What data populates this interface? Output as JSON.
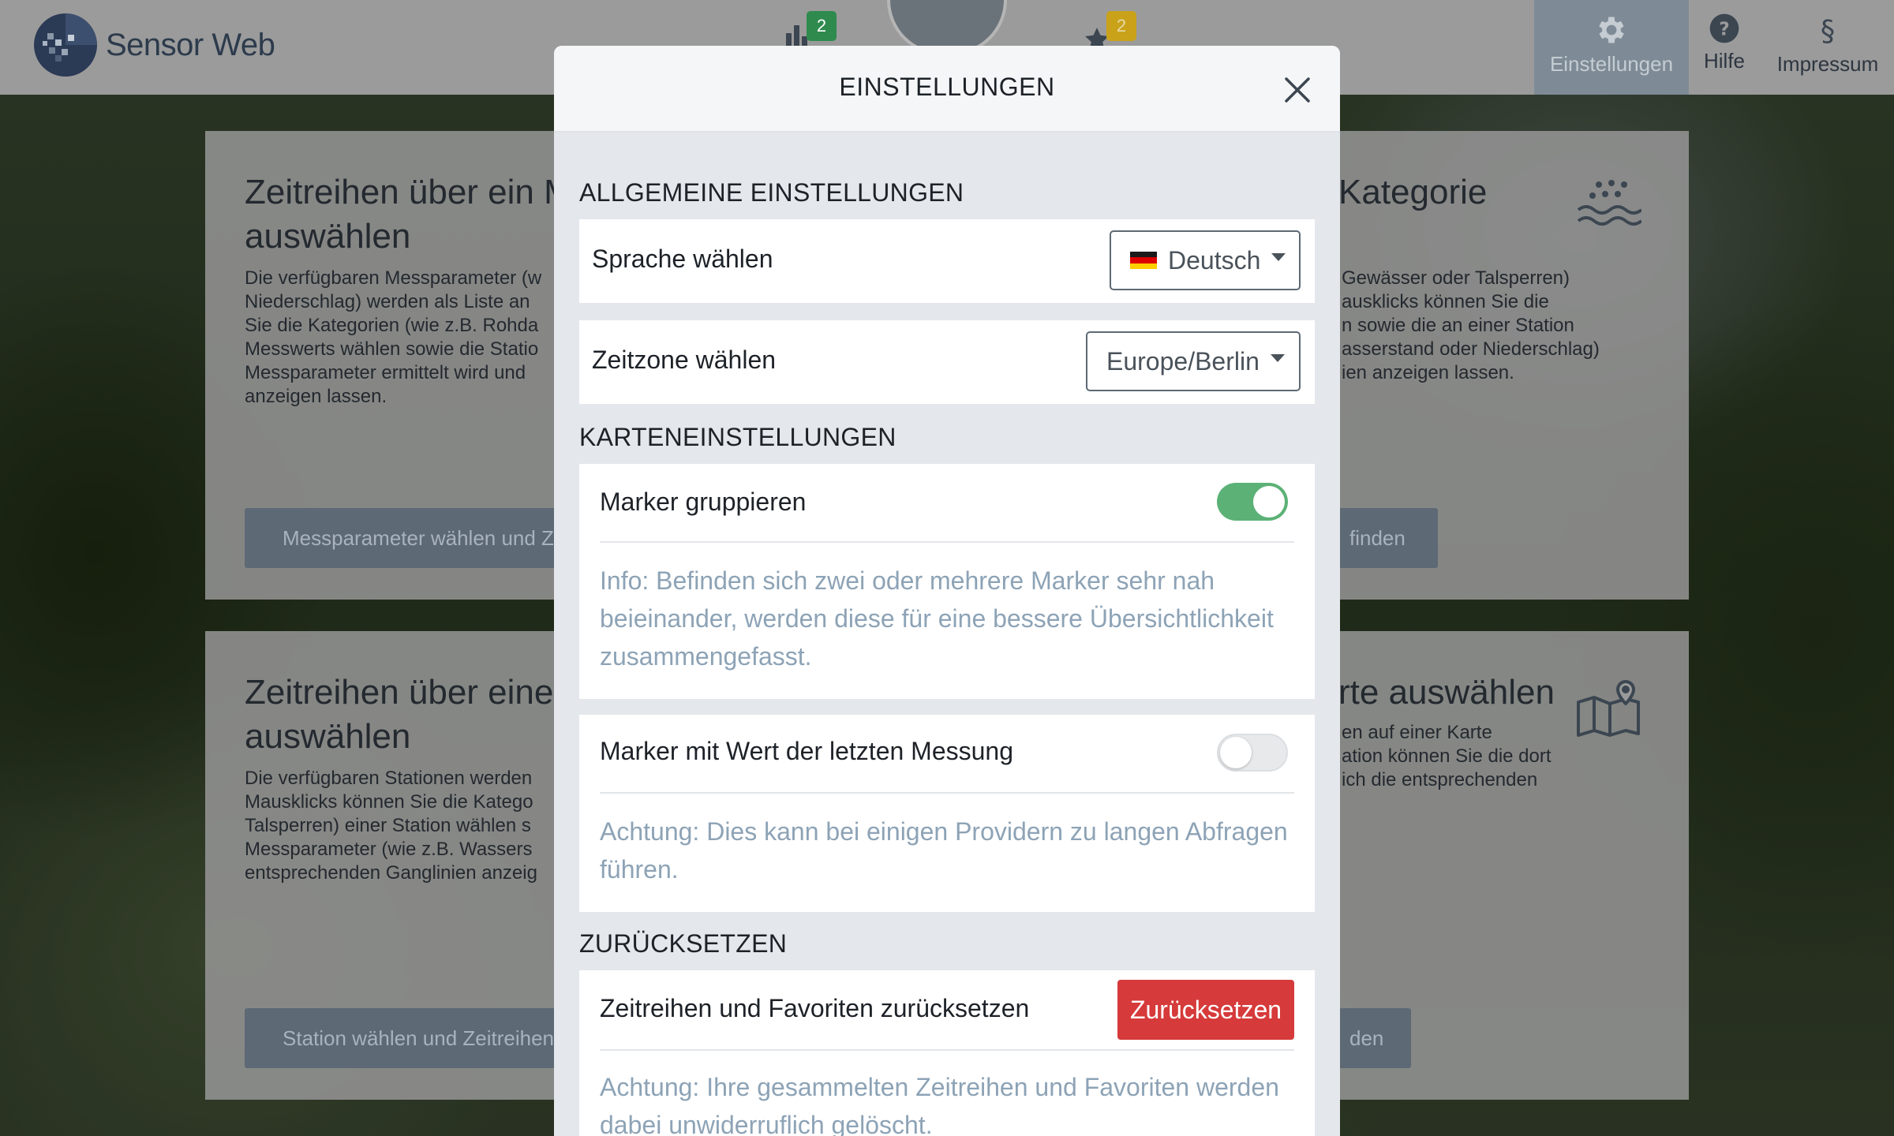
{
  "app": {
    "logo_text": "Sensor Web"
  },
  "topnav": {
    "diagram_badge": "2",
    "favorites_badge": "2",
    "items": [
      {
        "label": "Einstellungen",
        "icon": "gear-icon"
      },
      {
        "label": "Hilfe",
        "icon": "help-icon"
      },
      {
        "label": "Impressum",
        "icon": "paragraph-icon"
      }
    ]
  },
  "background_cards": {
    "card1": {
      "title_line1": "Zeitreihen über ein M",
      "title_line2": "auswählen",
      "text": [
        "Die verfügbaren Messparameter (w",
        "Niederschlag) werden als Liste an",
        "Sie die Kategorien (wie z.B. Rohda",
        "Messwerts wählen sowie die Statio",
        "Messparameter ermittelt wird und",
        "anzeigen lassen."
      ],
      "button": "Messparameter wählen und Z"
    },
    "card2": {
      "title_line1": "Kategorie",
      "text": [
        "Gewässer oder Talsperren)",
        "ausklicks können Sie die",
        "n sowie die an einer Station",
        "asserstand oder Niederschlag)",
        "ien anzeigen lassen."
      ],
      "button": "finden"
    },
    "card3": {
      "title_line1": "Zeitreihen über eine",
      "title_line2": "auswählen",
      "text": [
        "Die verfügbaren Stationen werden",
        "Mausklicks können Sie die Katego",
        "Talsperren) einer Station wählen s",
        "Messparameter (wie z.B. Wassers",
        "entsprechenden Ganglinien anzeig"
      ],
      "button": "Station wählen und Zeitreihen"
    },
    "card4": {
      "title_line1": "rte auswählen",
      "text": [
        "en auf einer Karte",
        "ation können Sie die dort",
        "ich die entsprechenden"
      ],
      "button": "den"
    }
  },
  "modal": {
    "title": "EINSTELLUNGEN",
    "general": {
      "section_title": "ALLGEMEINE EINSTELLUNGEN",
      "language_label": "Sprache wählen",
      "language_value": "Deutsch",
      "timezone_label": "Zeitzone wählen",
      "timezone_value": "Europe/Berlin"
    },
    "map": {
      "section_title": "KARTENEINSTELLUNGEN",
      "group_markers_label": "Marker gruppieren",
      "group_markers_on": true,
      "group_markers_info": "Info: Befinden sich zwei oder mehrere Marker sehr nah beieinander, werden diese für eine bessere Übersichtlichkeit zusammengefasst.",
      "last_value_label": "Marker mit Wert der letzten Messung",
      "last_value_on": false,
      "last_value_info": "Achtung: Dies kann bei einigen Providern zu langen Abfragen führen."
    },
    "reset": {
      "section_title": "ZURÜCKSETZEN",
      "label": "Zeitreihen und Favoriten zurücksetzen",
      "button": "Zurücksetzen",
      "info": "Achtung: Ihre gesammelten Zeitreihen und Favoriten werden dabei unwiderruflich gelöscht."
    }
  },
  "colors": {
    "toggle_on": "#5cb176",
    "reset_button": "#d63a3a",
    "info_text": "#8da3b6",
    "badge_green": "#2f8a4e",
    "badge_yellow": "#c9a21a"
  }
}
